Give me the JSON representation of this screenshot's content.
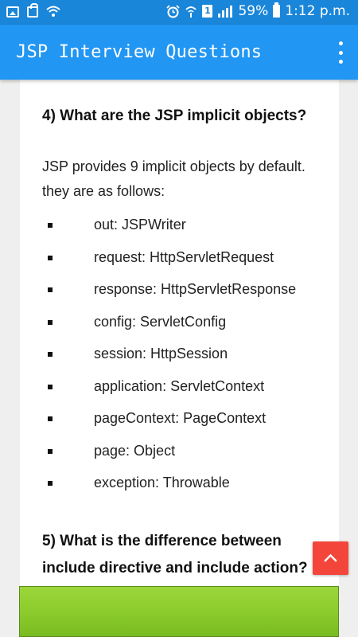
{
  "status_bar": {
    "battery_percent": "59%",
    "time": "1:12 p.m.",
    "sim_label": "1",
    "icons": [
      "image-icon",
      "bag-icon",
      "wifi-icon",
      "alarm-icon",
      "hotspot-icon",
      "sim-icon",
      "signal-icon",
      "battery-icon"
    ]
  },
  "app_bar": {
    "title": "JSP Interview Questions",
    "menu_icon": "overflow-menu-icon"
  },
  "content": {
    "question_4": "4) What are the JSP implicit objects?",
    "intro": "JSP provides 9 implicit objects by default. they are as follows:",
    "items": [
      "out: JSPWriter",
      "request: HttpServletRequest",
      "response: HttpServletResponse",
      "config: ServletConfig",
      "session: HttpSession",
      "application: ServletContext",
      "pageContext: PageContext",
      "page: Object",
      "exception: Throwable"
    ],
    "question_5": "5) What is the difference between include directive and include action?"
  },
  "scroll_top": {
    "icon": "chevron-up-icon",
    "color": "#f4453b"
  },
  "colors": {
    "status_bar": "#1a86d9",
    "app_bar": "#2196f3",
    "ad_banner": "#8ccc2c"
  }
}
